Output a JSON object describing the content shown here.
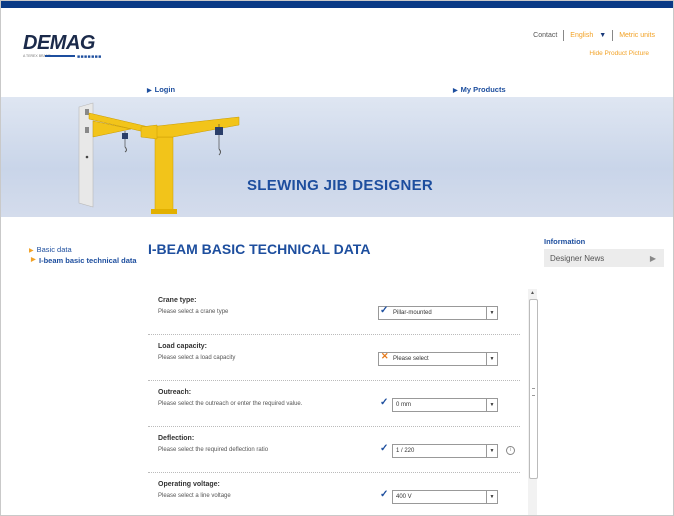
{
  "header": {
    "brand": "DEMAG",
    "brand_sub": "A TEREX BRAND",
    "contact": "Contact",
    "language": "English",
    "units": "Metric units",
    "hide_picture": "Hide Product Picture"
  },
  "nav": {
    "login": "Login",
    "my_products": "My Products"
  },
  "banner": {
    "title": "SLEWING JIB DESIGNER"
  },
  "sidebar": {
    "items": [
      {
        "label": "Basic data"
      },
      {
        "label": "I-beam basic technical data"
      }
    ]
  },
  "main": {
    "title": "I-BEAM BASIC TECHNICAL DATA"
  },
  "info": {
    "title": "Information",
    "item": "Designer News"
  },
  "form": {
    "rows": [
      {
        "label": "Crane type:",
        "hint": "Please select a crane type",
        "value": "Pillar-mounted",
        "status": "ok"
      },
      {
        "label": "Load capacity:",
        "hint": "Please select a load capacity",
        "value": "Please select",
        "status": "missing"
      },
      {
        "label": "Outreach:",
        "hint": "Please select the outreach or enter the required value.",
        "value": "0 mm",
        "status": "ok"
      },
      {
        "label": "Deflection:",
        "hint": "Please select the required deflection ratio",
        "value": "1 / 220",
        "status": "ok"
      },
      {
        "label": "Operating voltage:",
        "hint": "Please select a line voltage",
        "value": "400 V",
        "status": "ok"
      }
    ]
  },
  "colors": {
    "brand_blue": "#1d4e9e",
    "accent_orange": "#f2a226",
    "top_bar": "#0a3a86",
    "crane_yellow": "#f2c41a"
  }
}
